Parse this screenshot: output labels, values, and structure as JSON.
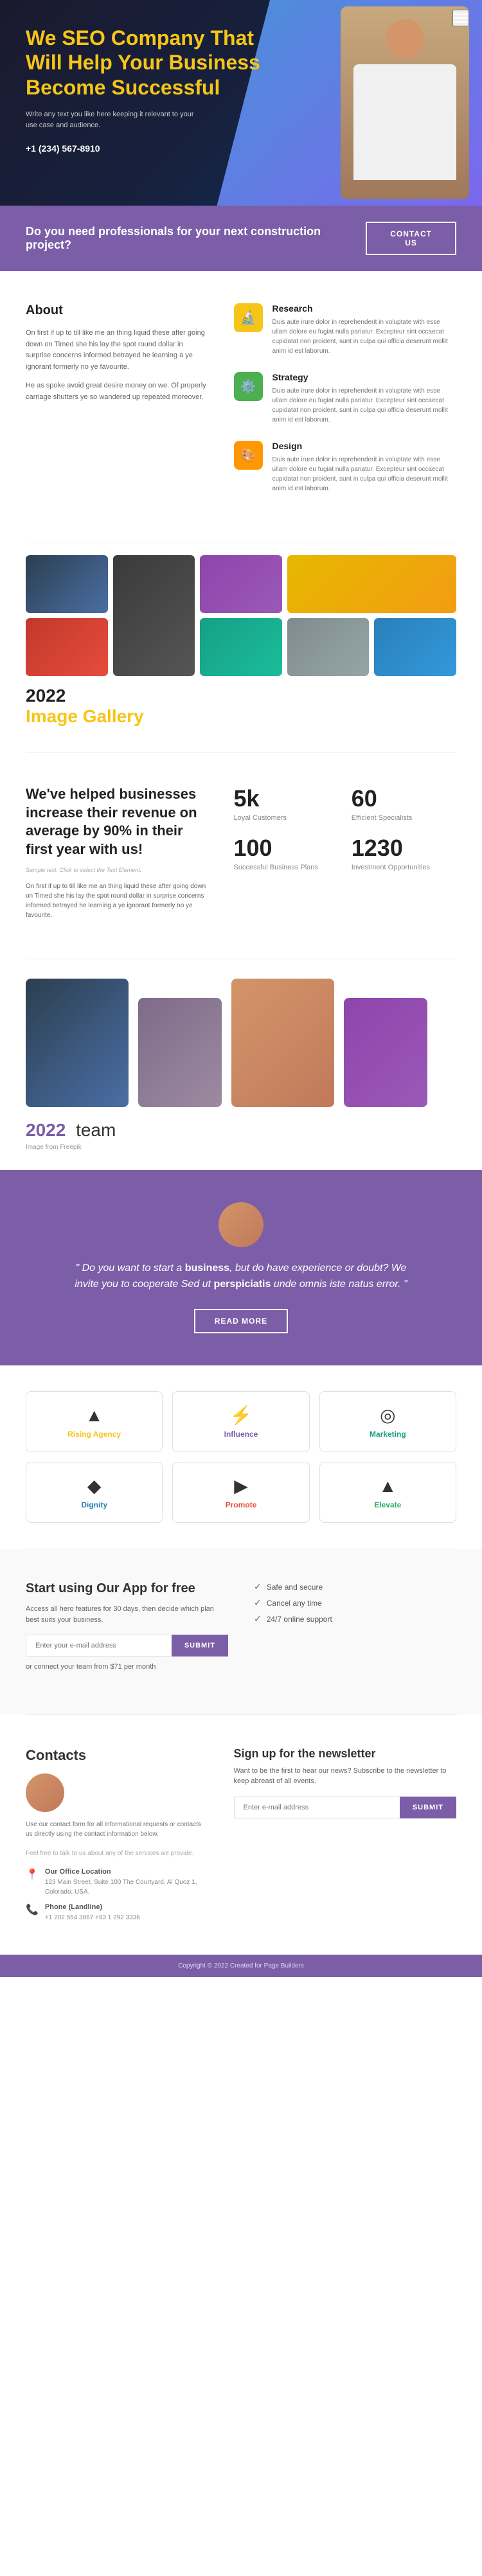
{
  "hero": {
    "title": "We SEO Company That Will Help Your Business Become Successful",
    "description": "Write any text you like here keeping it relevant to your use case and audience.",
    "phone": "+1 (234) 567-8910"
  },
  "cta_banner": {
    "question": "Do you need professionals for your next construction project?",
    "button_label": "CONTACT US"
  },
  "about": {
    "title": "About",
    "para1": "On first if up to till like me an thing liquid these after going down on Timed she his lay the spot round dollar in surprise concerns informed betrayed he learning a ye ignorant formerly no ye favourite.",
    "para2": "He as spoke avoid great desire money on we. Of properly carriage shutters ye so wandered up repeated moreover.",
    "services": [
      {
        "icon": "🔬",
        "icon_class": "icon-yellow",
        "title": "Research",
        "text": "Duis aute irure dolor in reprehenderit in voluptate with esse ullam dolore eu fugiat nulla pariatur. Excepteur sint occaecat cupidatat non proident, sunt in culpa qui officia deserunt mollit anim id est laborum."
      },
      {
        "icon": "⚙️",
        "icon_class": "icon-green",
        "title": "Strategy",
        "text": "Duis aute irure dolor in reprehenderit in voluptate with esse ullam dolore eu fugiat nulla pariatur. Excepteur sint occaecat cupidatat non proident, sunt in culpa qui officia deserunt mollit anim id est laborum."
      },
      {
        "icon": "🎨",
        "icon_class": "icon-orange",
        "title": "Design",
        "text": "Duis aute irure dolor in reprehenderit in voluptate with esse ullam dolore eu fugiat nulla pariatur. Excepteur sint occaecat cupidatat non proident, sunt in culpa qui officia deserunt mollit anim id est laborum."
      }
    ]
  },
  "gallery": {
    "year": "2022",
    "title": "Image Gallery",
    "title_color": "#f5c518"
  },
  "stats": {
    "headline": "We've helped businesses increase their revenue on average by 90% in their first year with us!",
    "sample_text": "Sample text. Click to select the Text Element.",
    "body": "On first if up to till like me an thing liquid these after going down on Timed she his lay the spot round dollar in surprise concerns informed betrayed he learning a ye ignorant formerly no ye favourite.",
    "items": [
      {
        "value": "5k",
        "label": "Loyal Customers"
      },
      {
        "value": "60",
        "label": "Efficient Specialists"
      },
      {
        "value": "100",
        "label": "Successful Business Plans"
      },
      {
        "value": "1230",
        "label": "Investment Opportunities"
      }
    ]
  },
  "team": {
    "year": "2022",
    "title": "team",
    "note": "Image from Freepik"
  },
  "quote": {
    "text": "\" Do you want to start a business, but do have experience or doubt? We invite you to cooperate Sed ut perspiciatis unde omnis iste natus error. \"",
    "button_label": "READ MORE"
  },
  "partners": [
    {
      "icon": "▲",
      "name": "Rising Agency",
      "color": "yellow"
    },
    {
      "icon": "⚡",
      "name": "Influence",
      "color": "purple"
    },
    {
      "icon": "◎",
      "name": "Marketing",
      "color": "teal"
    },
    {
      "icon": "◆",
      "name": "Dignity",
      "color": "blue"
    },
    {
      "icon": "▶",
      "name": "Promote",
      "color": "red"
    },
    {
      "icon": "▲",
      "name": "Elevate",
      "color": "green"
    }
  ],
  "app_cta": {
    "title": "Start using Our App for free",
    "description": "Access all hero features for 30 days, then decide which plan best suits your business.",
    "input_placeholder": "Enter your e-mail address",
    "button_label": "SUBMIT",
    "note": "or connect your team from $71 per month",
    "features": [
      "Safe and secure",
      "Cancel any time",
      "24/7 online support"
    ]
  },
  "contacts": {
    "title": "Contacts",
    "description": "Use our contact form for all informational requests or contacts us directly using the contact information below.",
    "note": "Feel free to talk to us about any of the services we provide.",
    "locations": [
      {
        "title": "Our Office Location",
        "address": "123 Main Street, Suite 100\nThe Courtyard, Al Quoz 1, Colorado, USA."
      },
      {
        "title": "Phone (Landline)",
        "phones": "+1 202 554 3867\n+93 1 292 3336"
      }
    ]
  },
  "newsletter": {
    "title": "Sign up for the newsletter",
    "description": "Want to be the first to hear our news? Subscribe to the newsletter to keep abreast of all events.",
    "input_placeholder": "Enter e-mail address",
    "button_label": "SUBMIT"
  },
  "footer": {
    "text": "Copyright © 2022 Created for Page Builders"
  }
}
